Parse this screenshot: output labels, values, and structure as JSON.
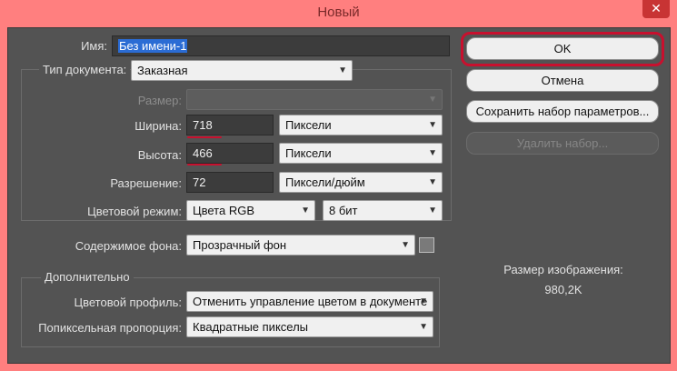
{
  "window": {
    "title": "Новый",
    "close_glyph": "✕"
  },
  "form": {
    "name_label": "Имя:",
    "name_value": "Без имени-1",
    "doc_type_label": "Тип документа:",
    "doc_type_value": "Заказная",
    "size_label": "Размер:",
    "size_value": "",
    "width_label": "Ширина:",
    "width_value": "718",
    "width_unit": "Пиксели",
    "height_label": "Высота:",
    "height_value": "466",
    "height_unit": "Пиксели",
    "resolution_label": "Разрешение:",
    "resolution_value": "72",
    "resolution_unit": "Пиксели/дюйм",
    "color_mode_label": "Цветовой режим:",
    "color_mode_value": "Цвета RGB",
    "bit_depth_value": "8 бит",
    "background_label": "Содержимое фона:",
    "background_value": "Прозрачный фон"
  },
  "advanced": {
    "title": "Дополнительно",
    "color_profile_label": "Цветовой профиль:",
    "color_profile_value": "Отменить управление цветом в документе",
    "pixel_aspect_label": "Попиксельная пропорция:",
    "pixel_aspect_value": "Квадратные пикселы"
  },
  "buttons": {
    "ok": "OK",
    "cancel": "Отмена",
    "save_preset": "Сохранить набор параметров...",
    "delete_preset": "Удалить набор..."
  },
  "image_size": {
    "label": "Размер изображения:",
    "value": "980,2K"
  },
  "icons": {
    "dropdown": "chevron-down-icon",
    "close": "close-icon"
  },
  "colors": {
    "title_bar": "#ff7f7f",
    "panel": "#535353",
    "accent_highlight": "#c8102e",
    "selection": "#2b6cd4"
  }
}
